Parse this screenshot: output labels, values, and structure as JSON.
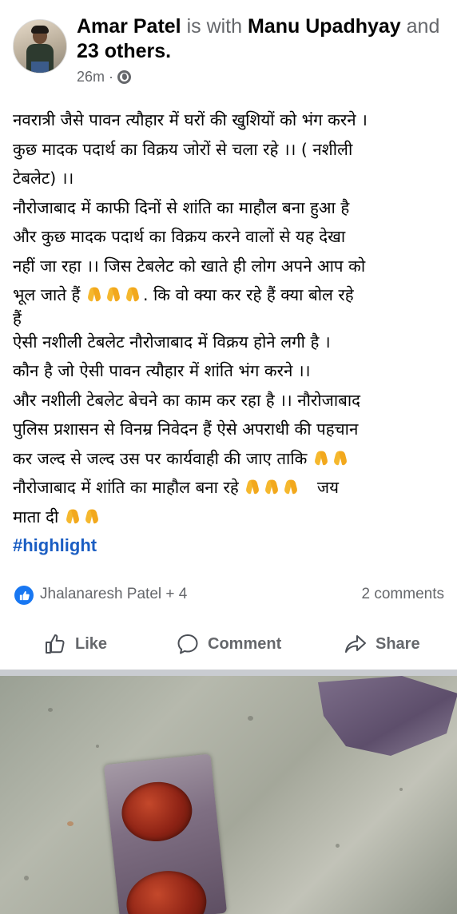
{
  "post": {
    "author": "Amar Patel",
    "with_text": "is with",
    "tagged": "Manu Upadhyay",
    "and_text": "and",
    "others": "23 others",
    "period": ".",
    "time": "26m",
    "dot": "·",
    "privacy_icon": "globe-icon",
    "lines": [
      "नवरात्री जैसे पावन त्यौहार में घरों की खुशियों को भंग करने ।",
      "कुछ मादक पदार्थ का विक्रय जोरों से चला रहे ।। ( नशीली",
      "टेबलेट) ।।",
      "नौरोजाबाद में काफी दिनों से शांति का माहौल बना हुआ है",
      "और कुछ मादक पदार्थ का विक्रय करने वालों से यह देखा",
      "नहीं जा रहा ।। जिस टेबलेट को खाते ही लोग अपने आप को",
      "भूल जाते हैं",
      ". कि वो क्या कर रहे हैं क्या  बोल रहे",
      "हैं",
      "ऐसी नशीली टेबलेट नौरोजाबाद में विक्रय होने लगी है ।",
      "कौन है जो ऐसी पावन त्यौहार में शांति भंग करने ।।",
      "और नशीली टेबलेट बेचने का काम कर रहा है ।। नौरोजाबाद",
      "पुलिस प्रशासन से विनम्र निवेदन हैं ऐसे अपराधी की पहचान",
      "कर जल्द से जल्द उस पर कार्यवाही की जाए ताकि",
      "नौरोजाबाद में शांति का माहौल बना रहे",
      "जय",
      "माता दी"
    ],
    "hashtag": "#highlight",
    "emoji": "folded-hands-emoji"
  },
  "reactions": {
    "icon": "like-icon",
    "names": "Jhalanaresh Patel + 4",
    "comments": "2 comments"
  },
  "actions": {
    "like": "Like",
    "comment": "Comment",
    "share": "Share"
  },
  "colors": {
    "link": "#1b5ec3",
    "like_blue": "#1877f2",
    "secondary_text": "#65676b"
  }
}
